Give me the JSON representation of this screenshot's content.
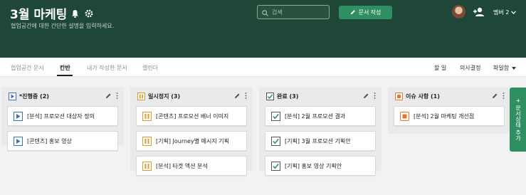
{
  "header": {
    "title": "3월 마케팅",
    "description": "협업공간에 대한 간단한 설명을 입력하세요.",
    "search_placeholder": "검색",
    "new_doc_label": "문서 작성",
    "members_label": "멤버 2"
  },
  "tabs": [
    {
      "label": "협업공간 문서",
      "active": false
    },
    {
      "label": "칸반",
      "active": true
    },
    {
      "label": "내가 작성한 문서",
      "active": false
    },
    {
      "label": "캘린더",
      "active": false
    }
  ],
  "right_tabs": [
    "할 일",
    "의사결정",
    "파일함"
  ],
  "columns": [
    {
      "title": "*진행중 (2)",
      "status": "in-progress",
      "color": "#3f6fb5",
      "cards": [
        "[분석] 프로모션 대상자 정의",
        "[콘텐츠] 홍보 영상"
      ]
    },
    {
      "title": "일시정지 (3)",
      "status": "paused",
      "color": "#e09b2d",
      "cards": [
        "[콘텐츠] 프로모션 배너 이미지",
        "[기획] Journey별 메시지 기획",
        "[분석] 타겟 액션 분석"
      ]
    },
    {
      "title": "완료 (3)",
      "status": "done",
      "color": "#2f8f63",
      "cards": [
        "[분석] 2월 프로모션 결과",
        "[기획] 3월 프로모션 기획안",
        "[기획] 홍보 영상 기획안"
      ]
    },
    {
      "title": "이슈 사항 (1)",
      "status": "issue",
      "color": "#e9752f",
      "cards": [
        "[분석] 2월 마케팅 개선점"
      ]
    }
  ],
  "fab_label": "+ 문서상태 추가",
  "colors": {
    "header_bg": "#1f4738",
    "accent_green": "#2f8f63"
  }
}
